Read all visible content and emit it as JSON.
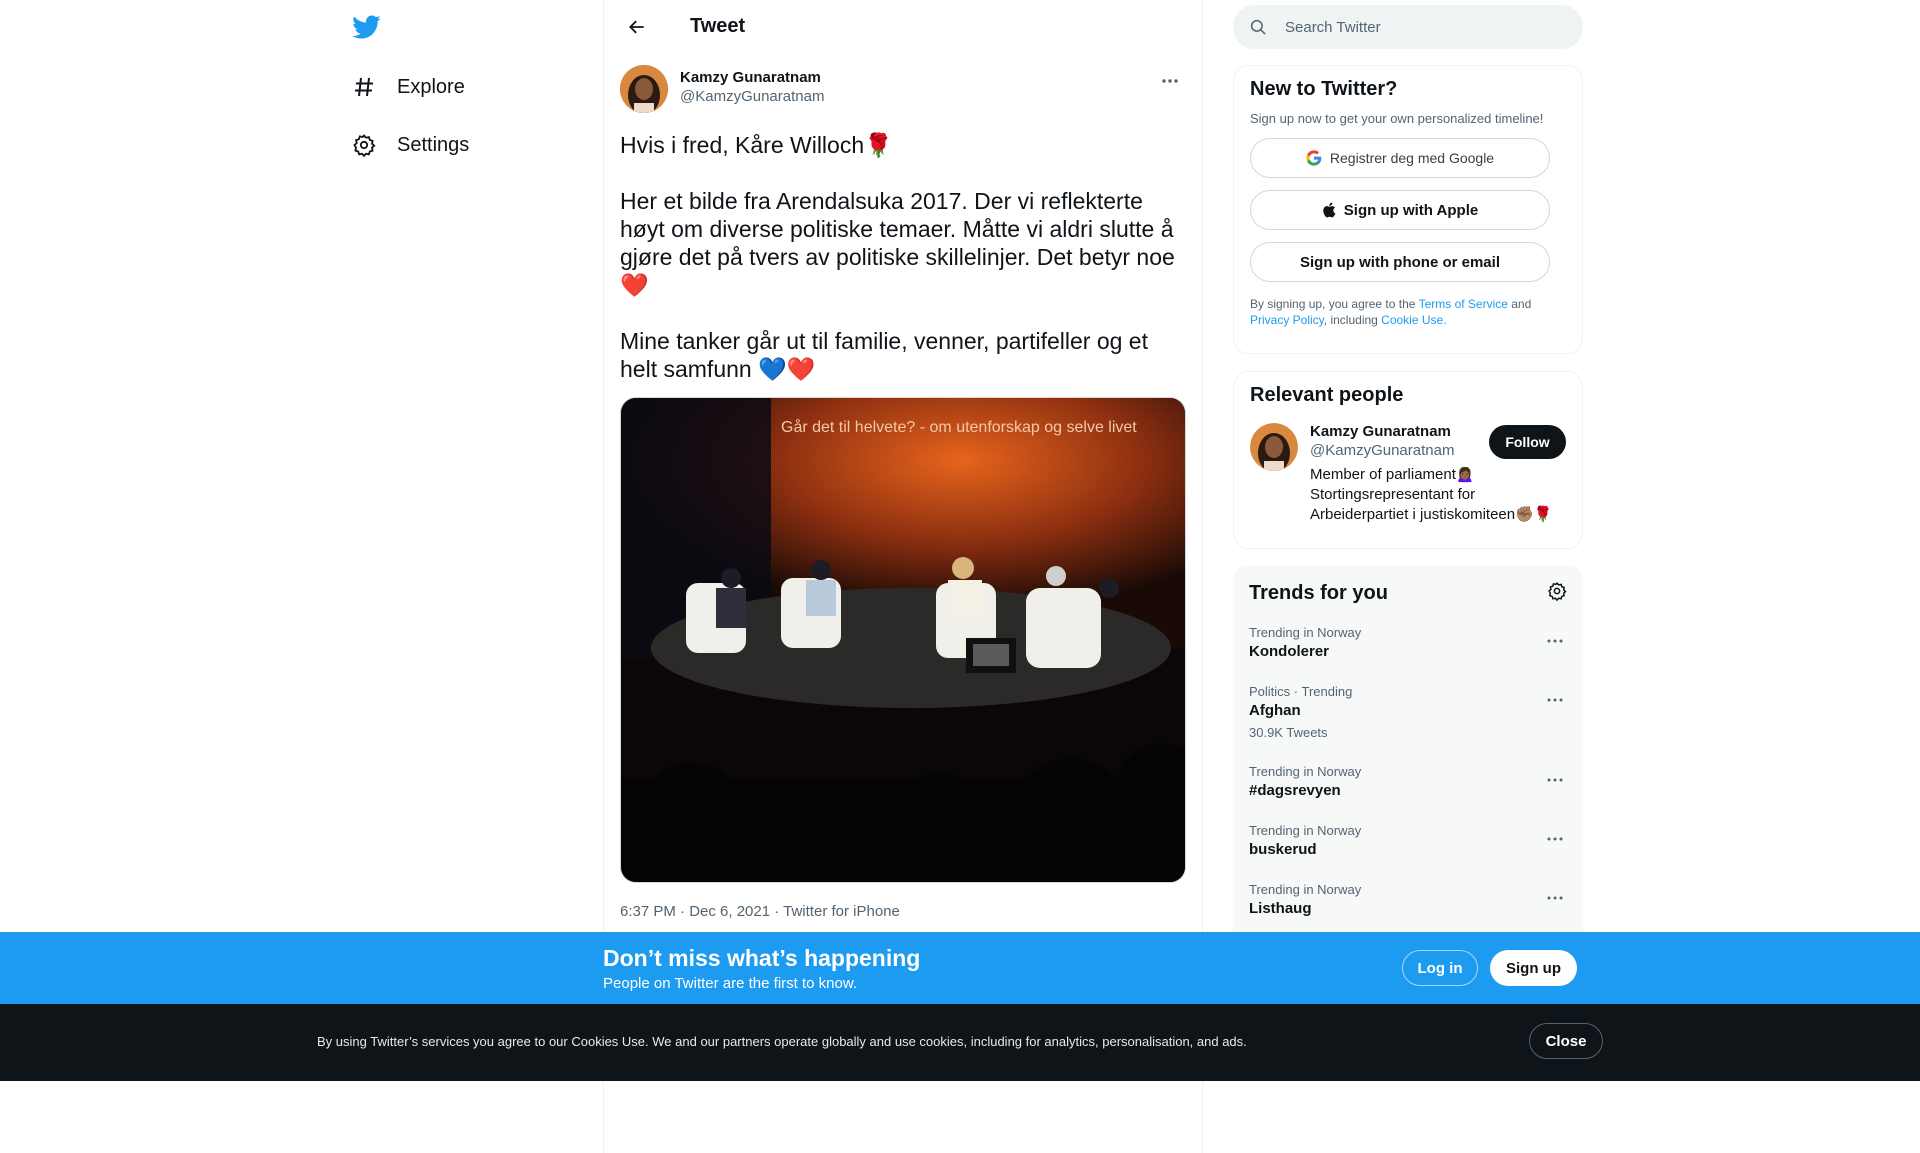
{
  "nav": {
    "items": [
      {
        "label": "Explore",
        "icon": "hashtag-icon"
      },
      {
        "label": "Settings",
        "icon": "gear-icon"
      }
    ]
  },
  "header": {
    "title": "Tweet"
  },
  "tweet": {
    "author_name": "Kamzy Gunaratnam",
    "author_handle": "@KamzyGunaratnam",
    "text": "Hvis i fred, Kåre Willoch🌹\n\nHer et bilde fra Arendalsuka 2017. Der vi reflekterte høyt om diverse politiske temaer. Måtte vi aldri slutte å gjøre det på tvers av politiske skillelinjer. Det betyr noe ❤️\n\nMine tanker går ut til familie, venner, partifeller og et helt samfunn 💙❤️",
    "media_caption": "Går det til helvete? - om utenforskap og selve livet",
    "meta": "6:37 PM · Dec 6, 2021 · Twitter for iPhone"
  },
  "search": {
    "placeholder": "Search Twitter"
  },
  "signup_card": {
    "title": "New to Twitter?",
    "subtitle": "Sign up now to get your own personalized timeline!",
    "google_label": "Registrer deg med Google",
    "apple_label": "Sign up with Apple",
    "phone_label": "Sign up with phone or email",
    "legal_prefix": "By signing up, you agree to the ",
    "terms": "Terms of Service",
    "and": " and ",
    "privacy": "Privacy Policy",
    "including": ", including ",
    "cookie": "Cookie Use."
  },
  "people_card": {
    "title": "Relevant people",
    "name": "Kamzy Gunaratnam",
    "handle": "@KamzyGunaratnam",
    "bio": "Member of parliament🙍🏾‍♀️ Stortingsrepresentant for Arbeiderpartiet i justiskomiteen✊🏽🌹",
    "follow_label": "Follow"
  },
  "trends": {
    "title": "Trends for you",
    "items": [
      {
        "context": "Trending in Norway",
        "name": "Kondolerer",
        "count": ""
      },
      {
        "context": "Politics · Trending",
        "name": "Afghan",
        "count": "30.9K Tweets"
      },
      {
        "context": "Trending in Norway",
        "name": "#dagsrevyen",
        "count": ""
      },
      {
        "context": "Trending in Norway",
        "name": "buskerud",
        "count": ""
      },
      {
        "context": "Trending in Norway",
        "name": "Listhaug",
        "count": ""
      }
    ]
  },
  "banner": {
    "title": "Don’t miss what’s happening",
    "subtitle": "People on Twitter are the first to know.",
    "login_label": "Log in",
    "signup_label": "Sign up"
  },
  "cookie_bar": {
    "text": "By using Twitter’s services you agree to our Cookies Use. We and our partners operate globally and use cookies, including for analytics, personalisation, and ads.",
    "close_label": "Close"
  },
  "colors": {
    "brand": "#1d9bf0",
    "text": "#0f1419",
    "secondary": "#536471",
    "dark_bar": "#0f1419"
  }
}
